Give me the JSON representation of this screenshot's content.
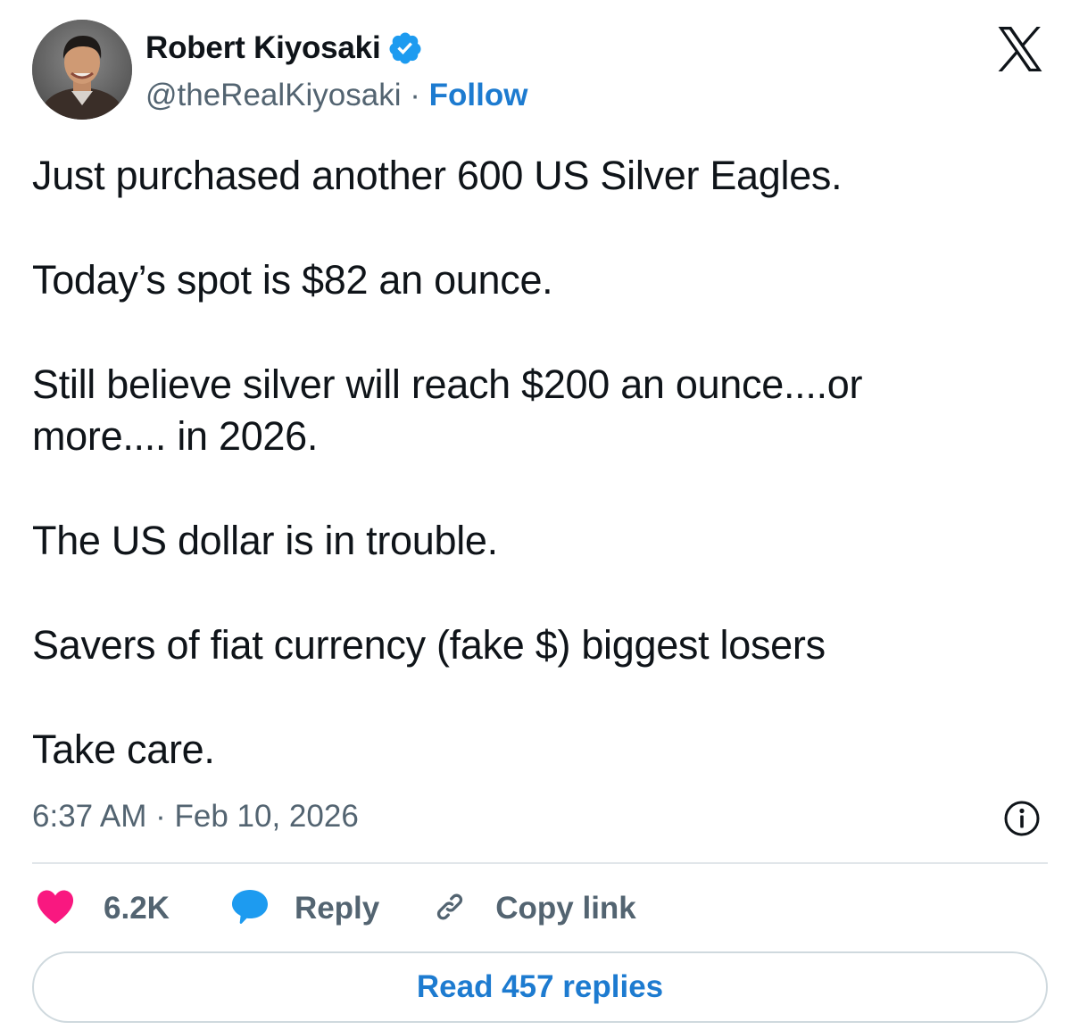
{
  "author": {
    "name": "Robert Kiyosaki",
    "handle": "@theRealKiyosaki",
    "separator": "·",
    "follow_label": "Follow",
    "verified": true
  },
  "tweet": {
    "paragraphs": [
      [
        "Just purchased another 600 US Silver Eagles."
      ],
      [
        "Today’s spot is $82 an ounce."
      ],
      [
        "Still believe silver will reach $200 an ounce....or",
        "more.... in 2026."
      ],
      [
        "The US dollar is in trouble."
      ],
      [
        "Savers of fiat currency (fake $) biggest losers"
      ],
      [
        "Take care."
      ]
    ],
    "timestamp": "6:37 AM · Feb 10, 2026"
  },
  "actions": {
    "like": {
      "icon": "heart-icon",
      "count": "6.2K"
    },
    "reply": {
      "icon": "speech-bubble-icon",
      "label": "Reply"
    },
    "copy_link": {
      "icon": "link-icon",
      "label": "Copy link"
    }
  },
  "read_replies_label": "Read 457 replies",
  "colors": {
    "text": "#0f1419",
    "secondary": "#536471",
    "accent_blue": "#1d7bd0",
    "like_pink": "#f91880",
    "reply_blue": "#1d9bf0",
    "border": "#cfd9de"
  }
}
